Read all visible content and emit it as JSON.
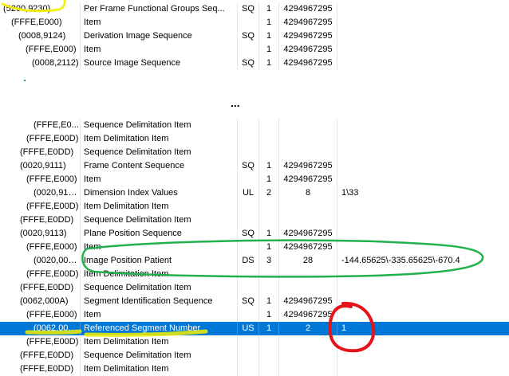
{
  "top_rows": [
    {
      "tag": "(5200,9230)",
      "indent": 4,
      "desc": "Per Frame Functional Groups Seq...",
      "vr": "SQ",
      "vm": "1",
      "len": "4294967295",
      "val": ""
    },
    {
      "tag": "(FFFE,E000)",
      "indent": 14,
      "desc": "Item",
      "vr": "",
      "vm": "1",
      "len": "4294967295",
      "val": ""
    },
    {
      "tag": "(0008,9124)",
      "indent": 23,
      "desc": "Derivation Image Sequence",
      "vr": "SQ",
      "vm": "1",
      "len": "4294967295",
      "val": ""
    },
    {
      "tag": "(FFFE,E000)",
      "indent": 32,
      "desc": "Item",
      "vr": "",
      "vm": "1",
      "len": "4294967295",
      "val": ""
    },
    {
      "tag": "(0008,2112)",
      "indent": 40,
      "desc": "Source Image Sequence",
      "vr": "SQ",
      "vm": "1",
      "len": "4294967295",
      "val": ""
    }
  ],
  "gap_text": "...",
  "bottom_rows": [
    {
      "tag": "(FFFE,E0...",
      "indent": 42,
      "desc": "Sequence Delimitation Item",
      "vr": "",
      "vm": "",
      "len": "",
      "val": ""
    },
    {
      "tag": "(FFFE,E00D)",
      "indent": 33,
      "desc": "Item Delimitation Item",
      "vr": "",
      "vm": "",
      "len": "",
      "val": ""
    },
    {
      "tag": "(FFFE,E0DD)",
      "indent": 25,
      "desc": "Sequence Delimitation Item",
      "vr": "",
      "vm": "",
      "len": "",
      "val": ""
    },
    {
      "tag": "(0020,9111)",
      "indent": 25,
      "desc": "Frame Content Sequence",
      "vr": "SQ",
      "vm": "1",
      "len": "4294967295",
      "val": ""
    },
    {
      "tag": "(FFFE,E000)",
      "indent": 33,
      "desc": "Item",
      "vr": "",
      "vm": "1",
      "len": "4294967295",
      "val": ""
    },
    {
      "tag": "(0020,9157)",
      "indent": 42,
      "desc": "Dimension Index Values",
      "vr": "UL",
      "vm": "2",
      "len": "8",
      "val": "1\\33"
    },
    {
      "tag": "(FFFE,E00D)",
      "indent": 33,
      "desc": "Item Delimitation Item",
      "vr": "",
      "vm": "",
      "len": "",
      "val": ""
    },
    {
      "tag": "(FFFE,E0DD)",
      "indent": 25,
      "desc": "Sequence Delimitation Item",
      "vr": "",
      "vm": "",
      "len": "",
      "val": ""
    },
    {
      "tag": "(0020,9113)",
      "indent": 25,
      "desc": "Plane Position Sequence",
      "vr": "SQ",
      "vm": "1",
      "len": "4294967295",
      "val": ""
    },
    {
      "tag": "(FFFE,E000)",
      "indent": 33,
      "desc": "Item",
      "vr": "",
      "vm": "1",
      "len": "4294967295",
      "val": ""
    },
    {
      "tag": "(0020,0032)",
      "indent": 42,
      "desc": "Image Position Patient",
      "vr": "DS",
      "vm": "3",
      "len": "28",
      "val": "-144.65625\\-335.65625\\-670.4"
    },
    {
      "tag": "(FFFE,E00D)",
      "indent": 33,
      "desc": "Item Delimitation Item",
      "vr": "",
      "vm": "",
      "len": "",
      "val": ""
    },
    {
      "tag": "(FFFE,E0DD)",
      "indent": 25,
      "desc": "Sequence Delimitation Item",
      "vr": "",
      "vm": "",
      "len": "",
      "val": ""
    },
    {
      "tag": "(0062,000A)",
      "indent": 25,
      "desc": "Segment Identification Sequence",
      "vr": "SQ",
      "vm": "1",
      "len": "4294967295",
      "val": ""
    },
    {
      "tag": "(FFFE,E000)",
      "indent": 33,
      "desc": "Item",
      "vr": "",
      "vm": "1",
      "len": "4294967295",
      "val": ""
    },
    {
      "tag": "(0062,000...",
      "indent": 42,
      "desc": "Referenced Segment Number",
      "vr": "US",
      "vm": "1",
      "len": "2",
      "val": "1",
      "selected": true
    },
    {
      "tag": "(FFFE,E00D)",
      "indent": 33,
      "desc": "Item Delimitation Item",
      "vr": "",
      "vm": "",
      "len": "",
      "val": ""
    },
    {
      "tag": "(FFFE,E0DD)",
      "indent": 25,
      "desc": "Sequence Delimitation Item",
      "vr": "",
      "vm": "",
      "len": "",
      "val": ""
    },
    {
      "tag": "(FFFE,E0DD)",
      "indent": 25,
      "desc": "Item Delimitation Item",
      "vr": "",
      "vm": "",
      "len": "",
      "val": ""
    }
  ],
  "colors": {
    "selection": "#0078d7",
    "highlighter": "#f2ef00",
    "green_annotation": "#22b14c",
    "red_annotation": "#e5141b"
  }
}
